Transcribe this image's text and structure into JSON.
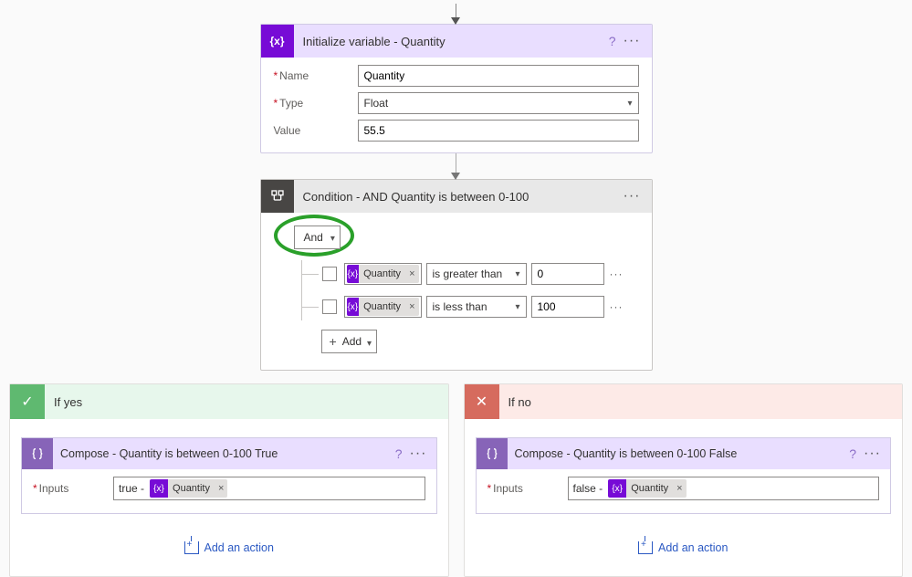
{
  "init_var": {
    "title": "Initialize variable - Quantity",
    "fields": {
      "name_label": "Name",
      "name_value": "Quantity",
      "type_label": "Type",
      "type_value": "Float",
      "value_label": "Value",
      "value_value": "55.5"
    }
  },
  "condition": {
    "title": "Condition - AND Quantity is between 0-100",
    "logic": "And",
    "rows": [
      {
        "token": "Quantity",
        "operator": "is greater than",
        "value": "0"
      },
      {
        "token": "Quantity",
        "operator": "is less than",
        "value": "100"
      }
    ],
    "add_label": "Add"
  },
  "branches": {
    "yes": {
      "label": "If yes",
      "compose_title": "Compose - Quantity is between 0-100 True",
      "inputs_label": "Inputs",
      "static": "true -",
      "token": "Quantity",
      "add_action": "Add an action"
    },
    "no": {
      "label": "If no",
      "compose_title": "Compose - Quantity is between 0-100 False",
      "inputs_label": "Inputs",
      "static": "false -",
      "token": "Quantity",
      "add_action": "Add an action"
    }
  },
  "glyphs": {
    "fx": "{x}",
    "compose": "{ }"
  }
}
